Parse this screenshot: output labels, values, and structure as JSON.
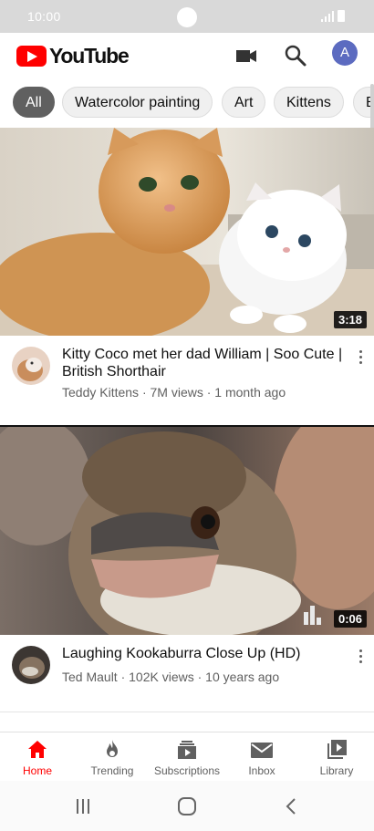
{
  "status_bar": {
    "time": "10:00"
  },
  "header": {
    "logo_text": "YouTube",
    "avatar_letter": "A",
    "icons": [
      "video-camera-icon",
      "search-icon"
    ]
  },
  "chips": [
    "All",
    "Watercolor painting",
    "Art",
    "Kittens",
    "B"
  ],
  "videos": [
    {
      "title": "Kitty Coco met  her dad William | Soo Cute | British Shorthair",
      "meta": "Teddy Kittens · 7M views · 1 month ago",
      "duration": "3:18"
    },
    {
      "title": "Laughing Kookaburra Close Up (HD)",
      "meta": "Ted Mault · 102K views · 10 years ago",
      "duration": "0:06"
    }
  ],
  "bottom_nav": [
    {
      "label": "Home",
      "icon": "home-icon"
    },
    {
      "label": "Trending",
      "icon": "flame-icon"
    },
    {
      "label": "Subscriptions",
      "icon": "subscriptions-icon"
    },
    {
      "label": "Inbox",
      "icon": "mail-icon"
    },
    {
      "label": "Library",
      "icon": "library-icon"
    }
  ],
  "colors": {
    "brand": "#ff0000",
    "active_chip": "#606060",
    "avatar": "#5c6bc0"
  }
}
